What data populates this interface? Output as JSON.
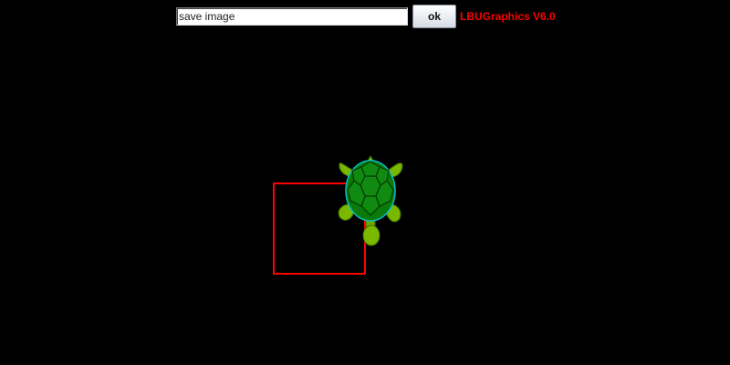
{
  "toolbar": {
    "command_value": "save image",
    "ok_label": "ok",
    "version_label": "LBUGraphics V6.0"
  },
  "canvas": {
    "background_color": "#000000",
    "drawn_shape": "square",
    "stroke_color": "#ff0000",
    "turtle_icon": "turtle-icon",
    "turtle_shell_color": "#0a7a0a",
    "turtle_limb_color": "#7ab800"
  }
}
